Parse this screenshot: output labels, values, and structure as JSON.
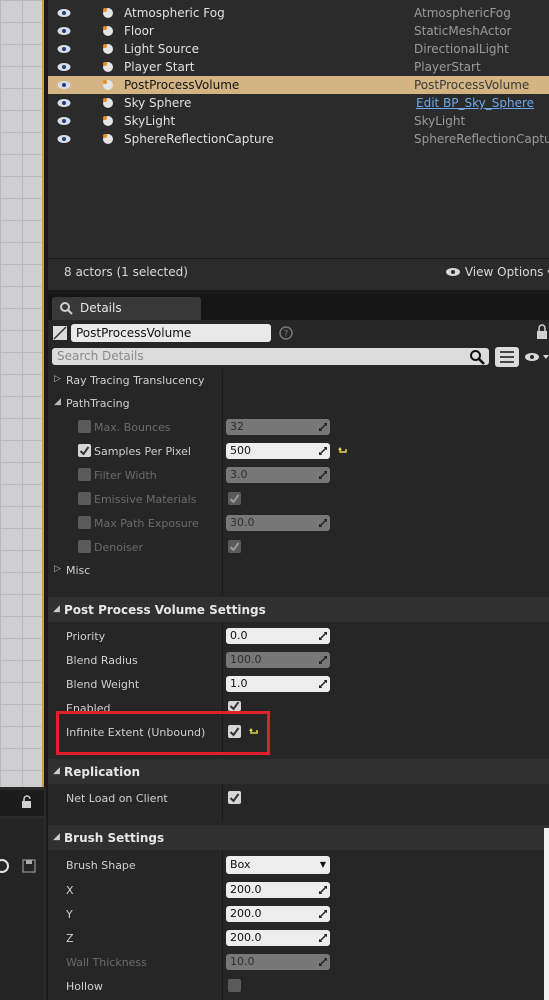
{
  "outliner": {
    "rows": [
      {
        "name": "Atmospheric Fog",
        "type": "AtmosphericFog",
        "icon": "fog-icon"
      },
      {
        "name": "Floor",
        "type": "StaticMeshActor",
        "icon": "mesh-icon"
      },
      {
        "name": "Light Source",
        "type": "DirectionalLight",
        "icon": "light-icon"
      },
      {
        "name": "Player Start",
        "type": "PlayerStart",
        "icon": "player-start-icon"
      },
      {
        "name": "PostProcessVolume",
        "type": "PostProcessVolume",
        "icon": "volume-icon"
      },
      {
        "name": "Sky Sphere",
        "type": "Edit BP_Sky_Sphere",
        "icon": "sphere-icon"
      },
      {
        "name": "SkyLight",
        "type": "SkyLight",
        "icon": "skylight-icon"
      },
      {
        "name": "SphereReflectionCapture",
        "type": "SphereReflectionCapture",
        "icon": "reflection-icon"
      }
    ],
    "actors_count": "8 actors (1 selected)",
    "view_options": "View Options"
  },
  "details": {
    "tab_label": "Details",
    "name_value": "PostProcessVolume",
    "search_placeholder": "Search Details",
    "ray_tracing_translucency": "Ray Tracing Translucency",
    "path_tracing": "PathTracing",
    "max_bounces_label": "Max. Bounces",
    "max_bounces_value": "32",
    "samples_per_pixel_label": "Samples Per Pixel",
    "samples_per_pixel_value": "500",
    "filter_width_label": "Filter Width",
    "filter_width_value": "3.0",
    "emissive_materials_label": "Emissive Materials",
    "max_path_exposure_label": "Max Path Exposure",
    "max_path_exposure_value": "30.0",
    "denoiser_label": "Denoiser",
    "misc": "Misc",
    "ppv_settings": "Post Process Volume Settings",
    "priority_label": "Priority",
    "priority_value": "0.0",
    "blend_radius_label": "Blend Radius",
    "blend_radius_value": "100.0",
    "blend_weight_label": "Blend Weight",
    "blend_weight_value": "1.0",
    "enabled_label": "Enabled",
    "infinite_extent_label": "Infinite Extent (Unbound)",
    "replication": "Replication",
    "net_load_label": "Net Load on Client",
    "brush_settings": "Brush Settings",
    "brush_shape_label": "Brush Shape",
    "brush_shape_value": "Box",
    "x_label": "X",
    "x_value": "200.0",
    "y_label": "Y",
    "y_value": "200.0",
    "z_label": "Z",
    "z_value": "200.0",
    "wall_thickness_label": "Wall Thickness",
    "wall_thickness_value": "10.0",
    "hollow_label": "Hollow"
  },
  "colors": {
    "selection": "#d4b483",
    "highlight_box": "#e0202a",
    "link": "#6fa7e8"
  }
}
